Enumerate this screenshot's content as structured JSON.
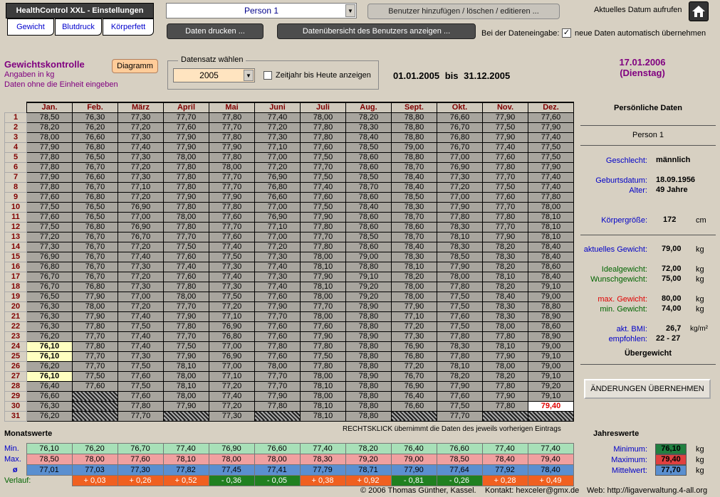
{
  "app": {
    "title": "HealthControl XXL - Einstellungen",
    "tabs": [
      "Gewicht",
      "Blutdruck",
      "Körperfett"
    ]
  },
  "top": {
    "person_select": "Person 1",
    "add_user": "Benutzer hinzufügen / löschen / editieren ...",
    "current_date_label": "Aktuelles Datum aufrufen",
    "print_data": "Daten drucken ...",
    "user_overview": "Datenübersicht des Benutzers anzeigen ...",
    "entry_label": "Bei der Dateneingabe:",
    "auto_accept_label": "neue Daten automatisch übernehmen",
    "auto_accept_checked": true
  },
  "section": {
    "title": "Gewichtskontrolle",
    "sub1": "Angaben in kg",
    "sub2": "Daten ohne die Einheit eingeben",
    "diagram_button": "Diagramm",
    "dataset_label": "Datensatz wählen",
    "year": "2005",
    "year_to_today_label": "Zeitjahr bis Heute anzeigen",
    "range_from": "01.01.2005",
    "range_mid": "bis",
    "range_to": "31.12.2005",
    "today_date": "17.01.2006",
    "today_day": "(Dienstag)"
  },
  "grid": {
    "months": [
      "Jan.",
      "Feb.",
      "März",
      "April",
      "Mai",
      "Juni",
      "Juli",
      "Aug.",
      "Sept.",
      "Okt.",
      "Nov.",
      "Dez."
    ],
    "rows": [
      [
        "78,50",
        "76,30",
        "77,30",
        "77,70",
        "77,80",
        "77,40",
        "78,00",
        "78,20",
        "78,80",
        "76,60",
        "77,90",
        "77,60"
      ],
      [
        "78,20",
        "76,20",
        "77,20",
        "77,60",
        "77,70",
        "77,20",
        "77,80",
        "78,30",
        "78,80",
        "76,70",
        "77,50",
        "77,90"
      ],
      [
        "78,00",
        "76,60",
        "77,30",
        "77,90",
        "77,80",
        "77,30",
        "77,80",
        "78,40",
        "78,80",
        "76,80",
        "77,90",
        "77,40"
      ],
      [
        "77,90",
        "76,80",
        "77,40",
        "77,90",
        "77,90",
        "77,10",
        "77,60",
        "78,50",
        "79,00",
        "76,70",
        "77,40",
        "77,50"
      ],
      [
        "77,80",
        "76,50",
        "77,30",
        "78,00",
        "77,80",
        "77,00",
        "77,50",
        "78,60",
        "78,80",
        "77,00",
        "77,60",
        "77,50"
      ],
      [
        "77,80",
        "76,70",
        "77,20",
        "77,80",
        "78,00",
        "77,20",
        "77,70",
        "78,60",
        "78,70",
        "76,90",
        "77,80",
        "77,90"
      ],
      [
        "77,90",
        "76,60",
        "77,30",
        "77,80",
        "77,70",
        "76,90",
        "77,50",
        "78,50",
        "78,40",
        "77,30",
        "77,70",
        "77,40"
      ],
      [
        "77,80",
        "76,70",
        "77,10",
        "77,80",
        "77,70",
        "76,80",
        "77,40",
        "78,70",
        "78,40",
        "77,20",
        "77,50",
        "77,40"
      ],
      [
        "77,60",
        "76,80",
        "77,20",
        "77,90",
        "77,90",
        "76,60",
        "77,60",
        "78,60",
        "78,50",
        "77,00",
        "77,60",
        "77,80"
      ],
      [
        "77,50",
        "76,50",
        "76,90",
        "77,80",
        "77,80",
        "77,00",
        "77,50",
        "78,40",
        "78,30",
        "77,90",
        "77,70",
        "78,00"
      ],
      [
        "77,60",
        "76,50",
        "77,00",
        "78,00",
        "77,60",
        "76,90",
        "77,90",
        "78,60",
        "78,70",
        "77,80",
        "77,80",
        "78,10"
      ],
      [
        "77,50",
        "76,80",
        "76,90",
        "77,80",
        "77,70",
        "77,10",
        "77,80",
        "78,60",
        "78,60",
        "78,30",
        "77,70",
        "78,10"
      ],
      [
        "77,20",
        "76,70",
        "76,70",
        "77,70",
        "77,60",
        "77,00",
        "77,70",
        "78,50",
        "78,70",
        "78,10",
        "77,90",
        "78,10"
      ],
      [
        "77,30",
        "76,70",
        "77,20",
        "77,50",
        "77,40",
        "77,20",
        "77,80",
        "78,60",
        "78,40",
        "78,30",
        "78,20",
        "78,40"
      ],
      [
        "76,90",
        "76,70",
        "77,40",
        "77,60",
        "77,50",
        "77,30",
        "78,00",
        "79,00",
        "78,30",
        "78,50",
        "78,30",
        "78,40"
      ],
      [
        "76,80",
        "76,70",
        "77,30",
        "77,40",
        "77,30",
        "77,40",
        "78,10",
        "78,80",
        "78,10",
        "77,90",
        "78,20",
        "78,60"
      ],
      [
        "76,70",
        "76,70",
        "77,20",
        "77,60",
        "77,40",
        "77,30",
        "77,90",
        "79,10",
        "78,20",
        "78,00",
        "78,10",
        "78,40"
      ],
      [
        "76,70",
        "76,80",
        "77,30",
        "77,80",
        "77,30",
        "77,40",
        "78,10",
        "79,20",
        "78,00",
        "77,80",
        "78,20",
        "79,10"
      ],
      [
        "76,50",
        "77,90",
        "77,00",
        "78,00",
        "77,50",
        "77,60",
        "78,00",
        "79,20",
        "78,00",
        "77,50",
        "78,40",
        "79,00"
      ],
      [
        "76,30",
        "78,00",
        "77,20",
        "77,70",
        "77,20",
        "77,90",
        "77,70",
        "78,90",
        "77,90",
        "77,50",
        "78,30",
        "78,80"
      ],
      [
        "76,30",
        "77,90",
        "77,40",
        "77,90",
        "77,10",
        "77,70",
        "78,00",
        "78,80",
        "77,10",
        "77,60",
        "78,30",
        "78,90"
      ],
      [
        "76,30",
        "77,80",
        "77,50",
        "77,80",
        "76,90",
        "77,60",
        "77,60",
        "78,80",
        "77,20",
        "77,50",
        "78,00",
        "78,60"
      ],
      [
        "76,20",
        "77,70",
        "77,40",
        "77,70",
        "76,80",
        "77,60",
        "77,90",
        "78,90",
        "77,30",
        "77,80",
        "77,80",
        "78,90"
      ],
      [
        "76,10",
        "77,80",
        "77,40",
        "77,50",
        "77,00",
        "77,80",
        "77,80",
        "78,80",
        "76,90",
        "78,30",
        "78,10",
        "79,00"
      ],
      [
        "76,10",
        "77,70",
        "77,30",
        "77,90",
        "76,90",
        "77,60",
        "77,50",
        "78,80",
        "76,80",
        "77,80",
        "77,90",
        "79,10"
      ],
      [
        "76,20",
        "77,70",
        "77,50",
        "78,10",
        "77,00",
        "78,00",
        "77,80",
        "78,80",
        "77,20",
        "78,10",
        "78,00",
        "79,00"
      ],
      [
        "76,10",
        "77,50",
        "77,60",
        "78,00",
        "77,10",
        "77,70",
        "78,00",
        "78,90",
        "76,70",
        "78,20",
        "78,20",
        "79,10"
      ],
      [
        "76,40",
        "77,60",
        "77,50",
        "78,10",
        "77,20",
        "77,70",
        "78,10",
        "78,80",
        "76,90",
        "77,90",
        "77,80",
        "79,20"
      ],
      [
        "76,60",
        "",
        "77,60",
        "78,00",
        "77,40",
        "77,90",
        "78,00",
        "78,80",
        "76,40",
        "77,60",
        "77,90",
        "79,10"
      ],
      [
        "76,30",
        "",
        "77,80",
        "77,90",
        "77,20",
        "77,80",
        "78,10",
        "78,80",
        "76,60",
        "77,50",
        "77,80",
        "79,40"
      ],
      [
        "76,20",
        "",
        "77,70",
        "",
        "77,30",
        "",
        "78,10",
        "78,80",
        "",
        "77,70",
        "",
        ""
      ]
    ],
    "hint": "RECHTSKLICK übernimmt die Daten des jeweils vorherigen Eintrags"
  },
  "monthly": {
    "title": "Monatswerte",
    "min_label": "Min.",
    "max_label": "Max.",
    "avg_label": "ø",
    "trend_label": "Verlauf:",
    "min": [
      "76,10",
      "76,20",
      "76,70",
      "77,40",
      "76,90",
      "76,60",
      "77,40",
      "78,20",
      "76,40",
      "76,60",
      "77,40",
      "77,40"
    ],
    "max": [
      "78,50",
      "78,00",
      "77,60",
      "78,10",
      "78,00",
      "78,00",
      "78,30",
      "79,20",
      "79,00",
      "78,50",
      "78,40",
      "79,40"
    ],
    "avg": [
      "77,01",
      "77,03",
      "77,30",
      "77,82",
      "77,45",
      "77,41",
      "77,79",
      "78,71",
      "77,90",
      "77,64",
      "77,92",
      "78,40"
    ],
    "trend": [
      "+ 0,03",
      "+ 0,26",
      "+ 0,52",
      "- 0,36",
      "- 0,05",
      "+ 0,38",
      "+ 0,92",
      "- 0,81",
      "- 0,26",
      "+ 0,28",
      "+ 0,49"
    ],
    "trend_colors": [
      "#f06020",
      "#f06020",
      "#f06020",
      "#208020",
      "#208020",
      "#f06020",
      "#f06020",
      "#208020",
      "#208020",
      "#f06020",
      "#f06020"
    ]
  },
  "personal": {
    "title": "Persönliche Daten",
    "name": "Person 1",
    "gender_label": "Geschlecht:",
    "gender": "männlich",
    "birth_label": "Geburtsdatum:",
    "birth": "18.09.1956",
    "age_label": "Alter:",
    "age": "49 Jahre",
    "height_label": "Körpergröße:",
    "height": "172",
    "height_unit": "cm",
    "current_label": "aktuelles Gewicht:",
    "current": "79,00",
    "ideal_label": "Idealgewicht:",
    "ideal": "72,00",
    "wish_label": "Wunschgewicht:",
    "wish": "75,00",
    "maxw_label": "max. Gewicht:",
    "maxw": "80,00",
    "minw_label": "min. Gewicht:",
    "minw": "74,00",
    "bmi_label": "akt. BMI:",
    "bmi": "26,7",
    "bmi_unit": "kg/m²",
    "recommended_label": "empfohlen:",
    "recommended": "22 - 27",
    "status": "Übergewicht",
    "kg": "kg",
    "apply_button": "ÄNDERUNGEN ÜBERNEHMEN"
  },
  "yearly": {
    "title": "Jahreswerte",
    "min_label": "Minimum:",
    "min": "76,10",
    "max_label": "Maximum:",
    "max": "79,40",
    "avg_label": "Mittelwert:",
    "avg": "77,70",
    "kg": "kg"
  },
  "footer": {
    "copyright": "© 2006 Thomas Günther, Kassel.",
    "contact": "Kontakt: hexceler@gmx.de",
    "web": "Web: http://ligaverwaltung.4-all.org"
  }
}
